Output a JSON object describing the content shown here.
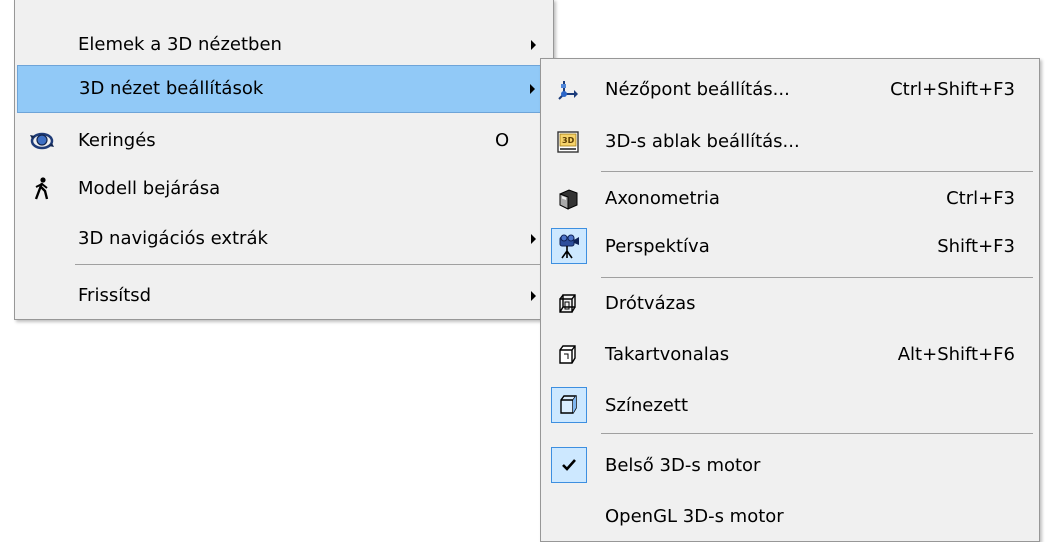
{
  "main_menu": {
    "items": [
      {
        "label": "Elemek a 3D nézetben",
        "shortcut": "",
        "submenu": true
      },
      {
        "label": "3D nézet beállítások",
        "shortcut": "",
        "submenu": true,
        "highlighted": true
      },
      {
        "label": "Keringés",
        "shortcut": "O",
        "icon": "orbit-icon"
      },
      {
        "label": "Modell bejárása",
        "shortcut": "",
        "icon": "walker-icon"
      },
      {
        "label": "3D navigációs extrák",
        "shortcut": "",
        "submenu": true
      },
      {
        "label": "Frissítsd",
        "shortcut": "",
        "submenu": true
      }
    ]
  },
  "sub_menu": {
    "items": [
      {
        "label": "Nézőpont beállítás...",
        "shortcut": "Ctrl+Shift+F3",
        "icon": "viewpoint-icon"
      },
      {
        "label": "3D-s ablak beállítás...",
        "shortcut": "",
        "icon": "3d-window-icon"
      },
      {
        "label": "Axonometria",
        "shortcut": "Ctrl+F3",
        "icon": "axonometry-icon"
      },
      {
        "label": "Perspektíva",
        "shortcut": "Shift+F3",
        "icon": "camera-icon",
        "checked": true
      },
      {
        "label": "Drótvázas",
        "shortcut": "",
        "icon": "wireframe-icon"
      },
      {
        "label": "Takartvonalas",
        "shortcut": "Alt+Shift+F6",
        "icon": "hidden-line-icon"
      },
      {
        "label": "Színezett",
        "shortcut": "",
        "icon": "shaded-icon",
        "checked": true
      },
      {
        "label": "Belső 3D-s motor",
        "shortcut": "",
        "icon": "checkmark-icon",
        "checked": true
      },
      {
        "label": "OpenGL 3D-s motor",
        "shortcut": ""
      }
    ]
  },
  "colors": {
    "highlight": "#91c9f7",
    "checked_bg": "#cde8ff",
    "menu_bg": "#f0f0f0"
  }
}
